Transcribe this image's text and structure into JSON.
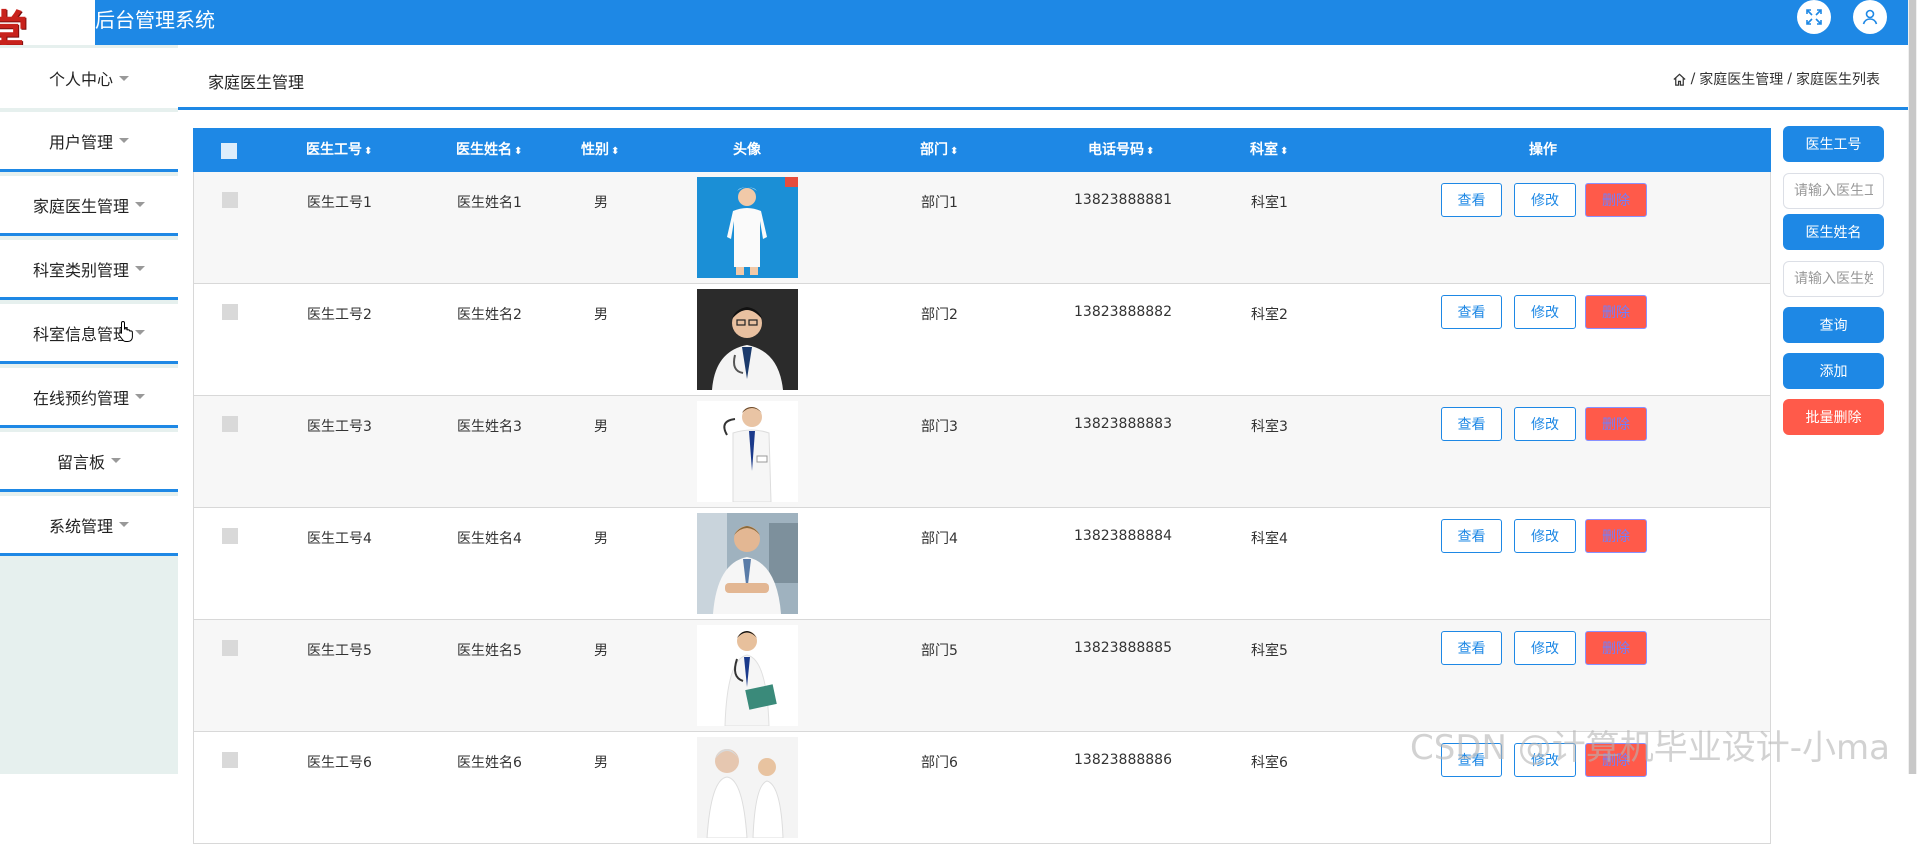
{
  "app": {
    "logo_text": "堂",
    "title": "后台管理系统"
  },
  "topbar_icons": [
    "fullscreen-icon",
    "user-icon"
  ],
  "sidebar": {
    "items": [
      {
        "label": "个人中心"
      },
      {
        "label": "用户管理"
      },
      {
        "label": "家庭医生管理"
      },
      {
        "label": "科室类别管理"
      },
      {
        "label": "科室信息管理"
      },
      {
        "label": "在线预约管理"
      },
      {
        "label": "留言板"
      },
      {
        "label": "系统管理"
      }
    ]
  },
  "header": {
    "page_title": "家庭医生管理",
    "breadcrumb": [
      "家庭医生管理",
      "家庭医生列表"
    ],
    "breadcrumb_sep": "/"
  },
  "table": {
    "columns": [
      "医生工号",
      "医生姓名",
      "性别",
      "头像",
      "部门",
      "电话号码",
      "科室",
      "操作"
    ],
    "sort_glyph": "⬍",
    "rows": [
      {
        "id": "医生工号1",
        "name": "医生姓名1",
        "gender": "男",
        "avatar": "nurse-photo",
        "dept": "部门1",
        "phone": "13823888881",
        "room": "科室1"
      },
      {
        "id": "医生工号2",
        "name": "医生姓名2",
        "gender": "男",
        "avatar": "doctor-photo",
        "dept": "部门2",
        "phone": "13823888882",
        "room": "科室2"
      },
      {
        "id": "医生工号3",
        "name": "医生姓名3",
        "gender": "男",
        "avatar": "doctor-photo",
        "dept": "部门3",
        "phone": "13823888883",
        "room": "科室3"
      },
      {
        "id": "医生工号4",
        "name": "医生姓名4",
        "gender": "男",
        "avatar": "doctor-photo",
        "dept": "部门4",
        "phone": "13823888884",
        "room": "科室4"
      },
      {
        "id": "医生工号5",
        "name": "医生姓名5",
        "gender": "男",
        "avatar": "doctor-photo",
        "dept": "部门5",
        "phone": "13823888885",
        "room": "科室5"
      },
      {
        "id": "医生工号6",
        "name": "医生姓名6",
        "gender": "男",
        "avatar": "doctor-photo",
        "dept": "部门6",
        "phone": "13823888886",
        "room": "科室6"
      }
    ],
    "actions": {
      "view": "查看",
      "edit": "修改",
      "delete": "删除"
    }
  },
  "search_panel": {
    "id_label": "医生工号",
    "id_placeholder": "请输入医生工号",
    "name_label": "医生姓名",
    "name_placeholder": "请输入医生姓名",
    "query": "查询",
    "add": "添加",
    "batch_delete": "批量删除"
  },
  "watermark": "CSDN @计算机毕业设计-小ma",
  "colors": {
    "primary": "#1e88e5",
    "danger": "#ff5a4a"
  }
}
